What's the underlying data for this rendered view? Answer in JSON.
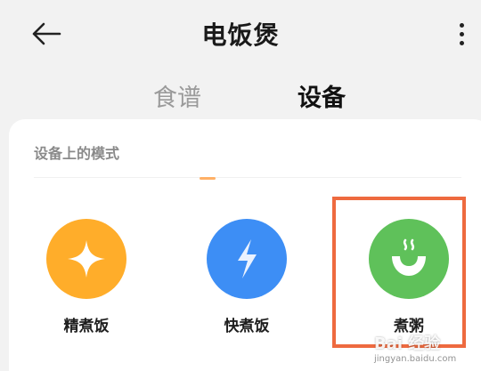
{
  "header": {
    "title": "电饭煲",
    "back_icon": "arrow-left-icon",
    "more_icon": "more-vertical-icon"
  },
  "tabs": [
    {
      "label": "食谱",
      "active": false
    },
    {
      "label": "设备",
      "active": true
    }
  ],
  "section": {
    "title": "设备上的模式"
  },
  "modes": [
    {
      "label": "精煮饭",
      "icon": "sparkle-icon",
      "color": "#ffad2a"
    },
    {
      "label": "快煮饭",
      "icon": "lightning-icon",
      "color": "#3d8ef5"
    },
    {
      "label": "煮粥",
      "icon": "bowl-steam-icon",
      "color": "#5fc15a"
    }
  ],
  "colors": {
    "highlight": "#ee6a3f",
    "accent_indicator": "#ffb066"
  },
  "watermark": {
    "line1": "Bai 经验",
    "line2": "jingyan.baidu.com"
  }
}
